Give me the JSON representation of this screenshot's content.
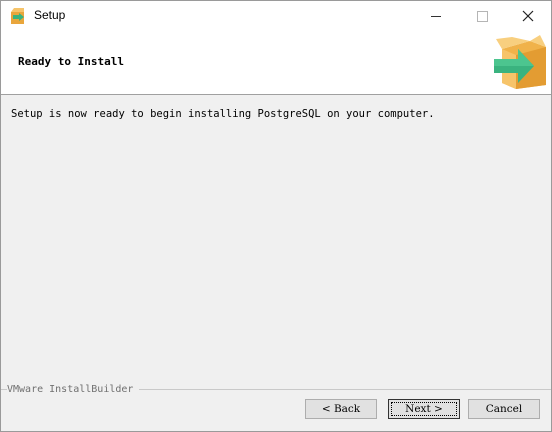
{
  "window": {
    "title": "Setup",
    "controls": {
      "minimize": "minimize",
      "maximize": "maximize",
      "close": "close"
    }
  },
  "header": {
    "title": "Ready to Install",
    "icon": "installer-box-icon"
  },
  "body": {
    "message": "Setup is now ready to begin installing PostgreSQL on your computer."
  },
  "footer": {
    "brand": "VMware InstallBuilder",
    "back_label": "< Back",
    "next_label": "Next >",
    "cancel_label": "Cancel"
  },
  "colors": {
    "box_orange": "#f0b24a",
    "arrow_green": "#3ab37f",
    "dialog_bg": "#f0f0f0"
  }
}
